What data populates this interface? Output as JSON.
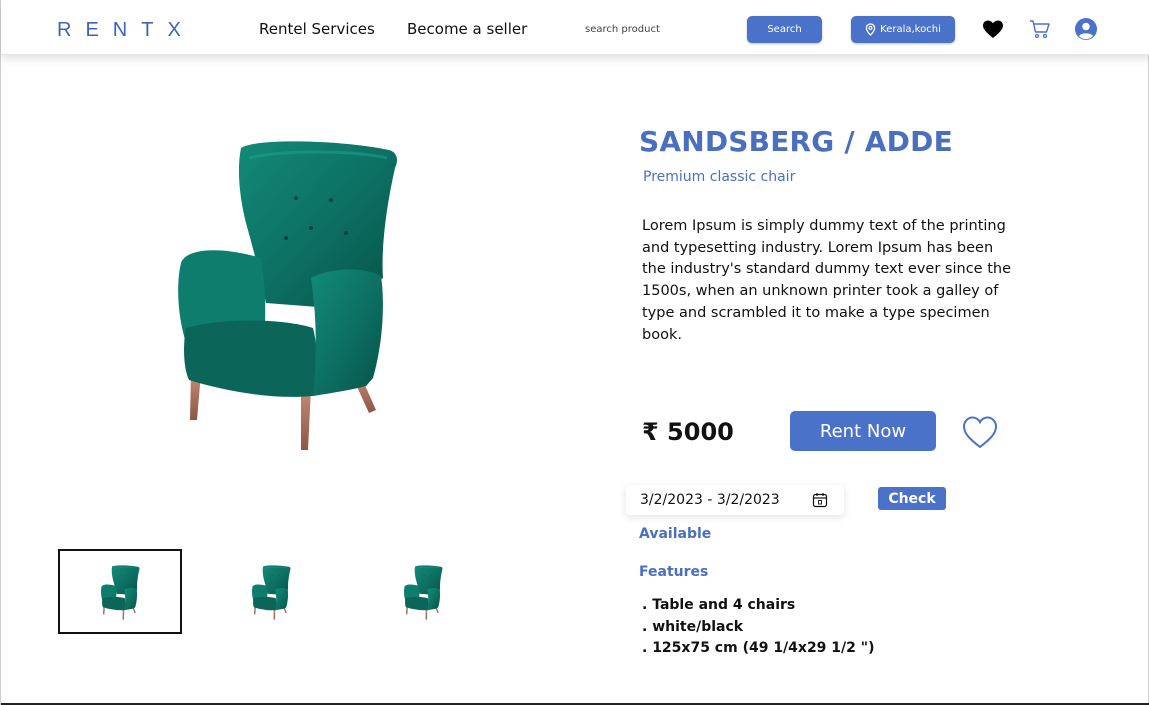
{
  "header": {
    "logo": "RENTX",
    "nav": {
      "rental_services": "Rentel Services",
      "become_seller": "Become a seller"
    },
    "search": {
      "placeholder": "search product",
      "button_label": "Search"
    },
    "location": {
      "label": "Kerala,kochi"
    },
    "icons": [
      "heart-icon",
      "cart-icon",
      "user-icon"
    ]
  },
  "product": {
    "title": "SANDSBERG / ADDE",
    "subtitle": "Premium classic chair",
    "description": "Lorem Ipsum is simply dummy text of the printing and typesetting industry. Lorem Ipsum has been the industry's standard dummy text ever since the 1500s, when an unknown printer took a galley of type and scrambled it to make a type specimen book.",
    "price": "₹ 5000",
    "rent_button": "Rent Now",
    "date_range": "3/2/2023 - 3/2/2023",
    "check_button": "Check",
    "availability": "Available",
    "features_title": "Features",
    "features": [
      ". Table and 4 chairs",
      ". white/black",
      ". 125x75 cm (49 1/4x29 1/2 \")"
    ]
  },
  "gallery": {
    "selected_index": 0,
    "thumbnail_count": 3
  },
  "colors": {
    "accent": "#4a72c9",
    "title": "#4a6fbf",
    "chair": "#0e7566"
  }
}
